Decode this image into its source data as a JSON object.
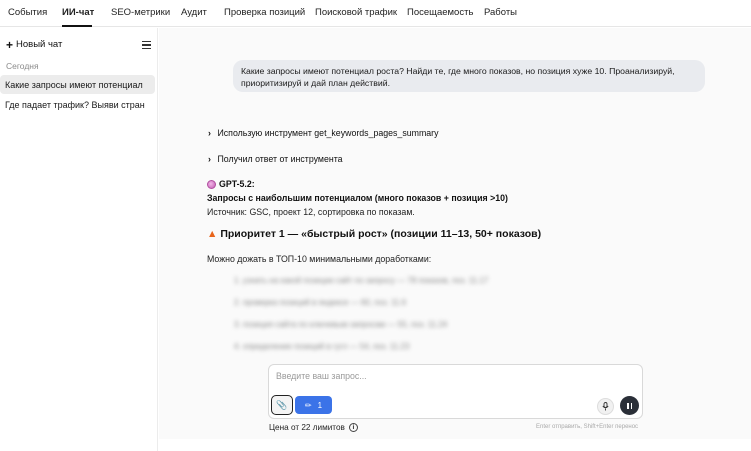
{
  "nav": {
    "tabs": [
      {
        "label": "События",
        "active": false
      },
      {
        "label": "ИИ-чат",
        "active": true
      },
      {
        "label": "SEO-метрики",
        "active": false
      },
      {
        "label": "Аудит",
        "active": false
      },
      {
        "label": "Проверка позиций",
        "active": false
      },
      {
        "label": "Поисковой трафик",
        "active": false
      },
      {
        "label": "Посещаемость",
        "active": false
      },
      {
        "label": "Работы",
        "active": false
      }
    ]
  },
  "sidebar": {
    "new_chat_label": "Новый чат",
    "section_label": "Сегодня",
    "chats": [
      {
        "title": "Какие запросы имеют потенциал",
        "active": true
      },
      {
        "title": "Где падает трафик? Выяви стран",
        "active": false
      }
    ]
  },
  "chat": {
    "user_message": "Какие запросы имеют потенциал роста? Найди те, где много показов, но позиция хуже 10. Проанализируй, приоритизируй и дай план действий.",
    "tool_call": "Использую инструмент get_keywords_pages_summary",
    "tool_result": "Получил ответ от инструмента",
    "model_name": "GPT-5.2:",
    "answer_title": "Запросы с наибольшим потенциалом (много показов + позиция >10)",
    "answer_source": "Источник: GSC, проект 12, сортировка по показам.",
    "priority_heading": "Приоритет 1 — «быстрый рост» (позиции 11–13, 50+ показов)",
    "priority_text": "Можно дожать в ТОП-10 минимальными доработками:",
    "blurred_items": [
      "1. узнать на какой позиции сайт по запросу — 78 показов, поз. 11.17",
      "2. проверка позиций в яндексе — 60, поз. 11.6",
      "3. позиция сайта по ключевым запросам — 55, поз. 11.24",
      "4. определение позиций в гугл — 54, поз. 11.23"
    ]
  },
  "composer": {
    "placeholder": "Введите ваш запрос...",
    "tools_count": "1",
    "price_label": "Цена от 22 лимитов",
    "hint": "Enter отправить, Shift+Enter перенос"
  },
  "colors": {
    "accent": "#3b73e8",
    "user_bubble": "#e9ebef",
    "send_button": "#2a2f38"
  }
}
